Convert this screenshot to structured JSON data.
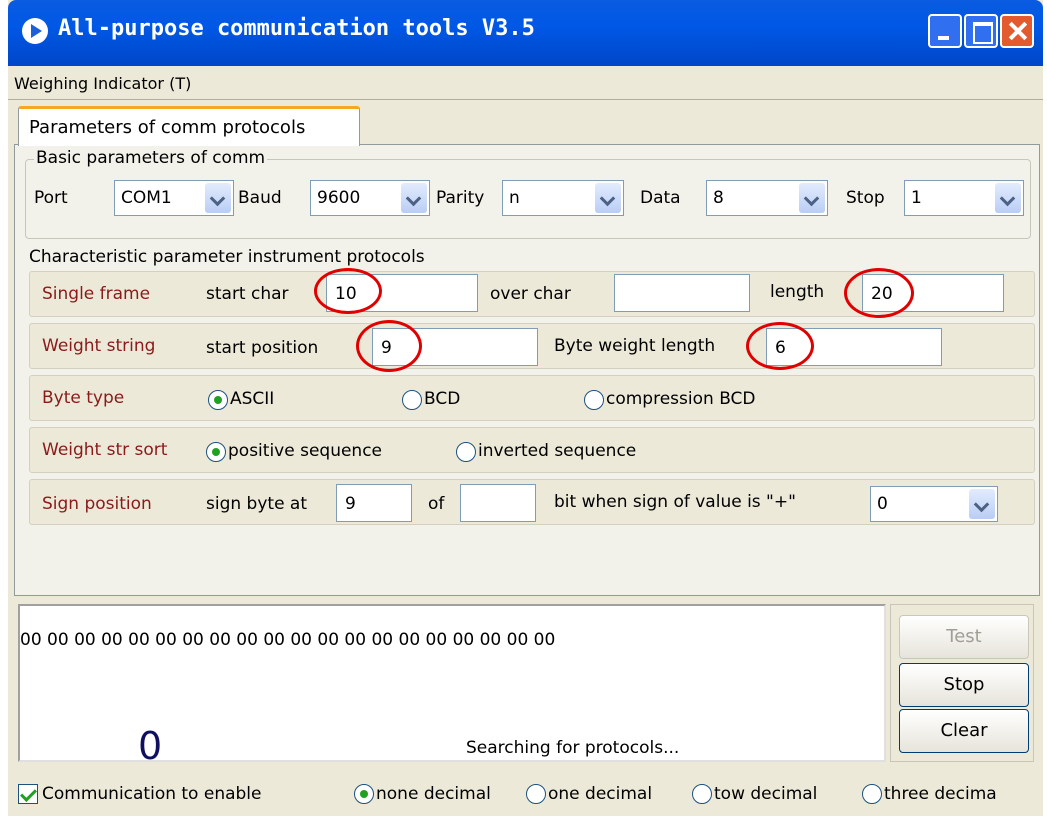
{
  "window": {
    "title": "All-purpose  communication tools V3.5"
  },
  "menu": {
    "weighing_indicator": "Weighing Indicator (T)"
  },
  "tab": {
    "label": "Parameters of comm protocols"
  },
  "basic": {
    "group_label": "Basic parameters of comm",
    "port_label": "Port",
    "port_value": "COM1",
    "baud_label": "Baud",
    "baud_value": "9600",
    "parity_label": "Parity",
    "parity_value": "n",
    "data_label": "Data",
    "data_value": "8",
    "stop_label": "Stop",
    "stop_value": "1"
  },
  "proto": {
    "group_label": "Characteristic parameter instrument  protocols",
    "single_frame": {
      "label": "Single frame",
      "start_char_label": "start char",
      "start_char_value": "10",
      "over_char_label": "over char",
      "over_char_value": "",
      "length_label": "length",
      "length_value": "20"
    },
    "weight_string": {
      "label": "Weight string",
      "start_position_label": "start position",
      "start_position_value": "9",
      "byte_weight_length_label": "Byte  weight length",
      "weight_length_value": "6"
    },
    "byte_type": {
      "label": "Byte type",
      "options": [
        "ASCII",
        "BCD",
        "compression BCD"
      ],
      "selected": "ASCII"
    },
    "weight_sort": {
      "label": "Weight str sort",
      "options": [
        "positive sequence",
        "inverted sequence"
      ],
      "selected": "positive sequence"
    },
    "sign": {
      "label": "Sign position",
      "sign_byte_at_label": "sign byte at",
      "sign_byte_value": "9",
      "of_label": "of",
      "of_value": "",
      "bit_label": "bit  when sign of value is \"+\"",
      "plus_value": "0"
    }
  },
  "output": {
    "hex": "00 00 00 00 00 00 00 00 00 00 00 00 00 00 00 00 00 00 00 00",
    "weight": "0",
    "status": "Searching for protocols..."
  },
  "buttons": {
    "test": "Test",
    "stop": "Stop",
    "clear": "Clear"
  },
  "bottom": {
    "enable_label": "Communication to enable",
    "decimals": [
      "none decimal",
      "one decimal",
      "tow decimal",
      "three decima"
    ],
    "selected": "none decimal"
  },
  "colors": {
    "title_bar": "#0058e6",
    "label_red": "#8b1a1a",
    "highlight_circle": "#e00000"
  }
}
